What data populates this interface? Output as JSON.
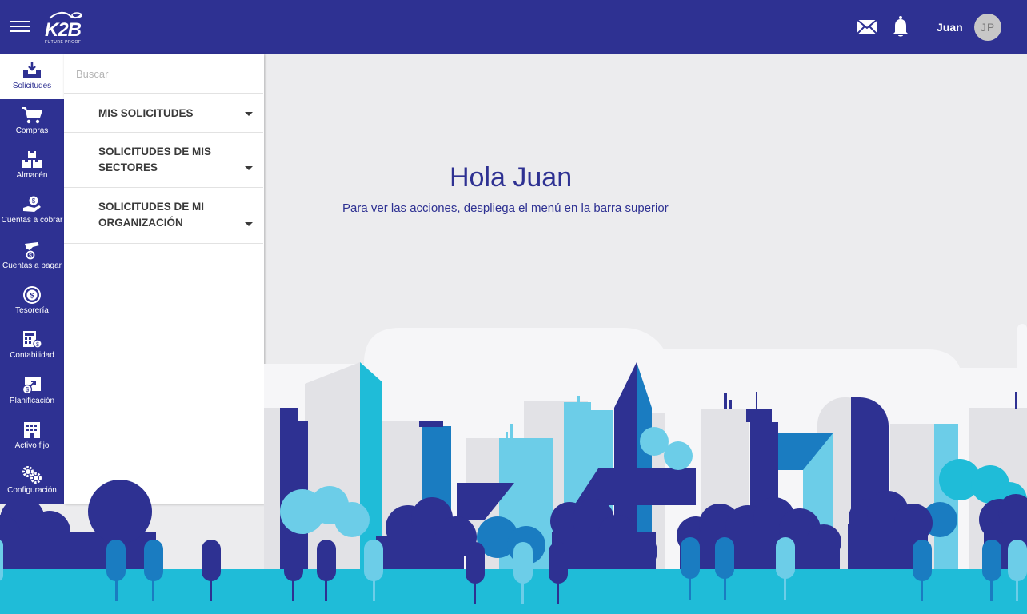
{
  "header": {
    "logo_text": "K2B",
    "logo_tagline": "FUTURE PROOF",
    "user_name": "Juan",
    "avatar_initials": "JP"
  },
  "sidebar": {
    "items": [
      {
        "label": "Solicitudes",
        "icon": "inbox-icon",
        "active": true
      },
      {
        "label": "Compras",
        "icon": "cart-icon"
      },
      {
        "label": "Almacén",
        "icon": "boxes-icon"
      },
      {
        "label": "Cuentas a cobrar",
        "icon": "hand-coin-icon"
      },
      {
        "label": "Cuentas a pagar",
        "icon": "hand-pay-icon"
      },
      {
        "label": "Tesorería",
        "icon": "treasury-coin-icon"
      },
      {
        "label": "Contabilidad",
        "icon": "calculator-icon"
      },
      {
        "label": "Planificación",
        "icon": "chart-money-icon"
      },
      {
        "label": "Activo fijo",
        "icon": "building-icon"
      },
      {
        "label": "Configuración",
        "icon": "gears-icon"
      }
    ]
  },
  "menu": {
    "search_placeholder": "Buscar",
    "items": [
      {
        "label": "MIS SOLICITUDES"
      },
      {
        "label": "SOLICITUDES DE MIS SECTORES"
      },
      {
        "label": "SOLICITUDES DE MI ORGANIZACIÓN"
      }
    ]
  },
  "main": {
    "greeting": "Hola Juan",
    "instructions": "Para ver las acciones, despliega el menú en la barra superior"
  },
  "colors": {
    "primary": "#2e3192",
    "light_blue": "#6ccde8",
    "cyan": "#1fbcd8",
    "mid_blue": "#1a7cc1",
    "background": "#ececee"
  }
}
